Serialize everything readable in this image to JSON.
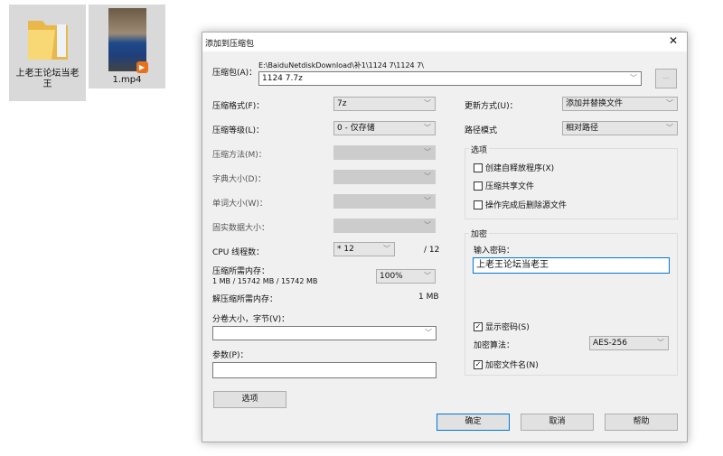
{
  "desktop": {
    "folder_label": "上老王论坛当老王",
    "video_label": "1.mp4"
  },
  "dialog": {
    "title": "添加到压缩包",
    "archive_label": "压缩包(A)：",
    "archive_path": "E:\\BaiduNetdiskDownload\\补1\\1124 7\\1124 7\\",
    "archive_name": "1124 7.7z",
    "browse": "...",
    "format_label": "压缩格式(F)：",
    "format_value": "7z",
    "level_label": "压缩等级(L)：",
    "level_value": "0 - 仅存储",
    "method_label": "压缩方法(M)：",
    "dict_label": "字典大小(D)：",
    "word_label": "单词大小(W)：",
    "solid_label": "固实数据大小：",
    "cpu_label": "CPU 线程数：",
    "cpu_value": "* 12",
    "cpu_total": "/ 12",
    "mem_label": "压缩所需内存：",
    "mem_detail": "1 MB / 15742 MB / 15742 MB",
    "mem_percent": "100%",
    "decomp_label": "解压缩所需内存：",
    "decomp_value": "1 MB",
    "volume_label": "分卷大小，字节(V)：",
    "volume_value": "",
    "params_label": "参数(P)：",
    "params_value": "",
    "update_label": "更新方式(U)：",
    "update_value": "添加并替换文件",
    "path_label": "路径模式",
    "path_value": "相对路径",
    "options_group": "选项",
    "options": [
      {
        "label": "创建自释放程序(X)",
        "checked": false
      },
      {
        "label": "压缩共享文件",
        "checked": false
      },
      {
        "label": "操作完成后删除源文件",
        "checked": false
      }
    ],
    "enc_group": "加密",
    "pwd_label": "输入密码：",
    "pwd_value": "上老王论坛当老王",
    "show_pwd": "显示密码(S)",
    "enc_method_label": "加密算法：",
    "enc_method_value": "AES-256",
    "enc_names": "加密文件名(N)",
    "options_btn": "选项",
    "ok": "确定",
    "cancel": "取消",
    "help": "帮助",
    "close": "✕",
    "check": "✓",
    "chev": "﹀"
  }
}
